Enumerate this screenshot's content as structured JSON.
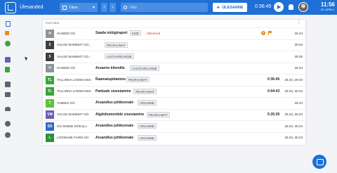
{
  "app": {
    "title": "Ülesanded"
  },
  "toolbar": {
    "date_value": "Täna",
    "prev_label": "‹",
    "next_label": "›",
    "search_placeholder": "Otsi",
    "new_button": "ÜLESANNE",
    "timer": "0:36:45"
  },
  "clock": {
    "time": "11:56",
    "date": "25. APRILL"
  },
  "sidebar": {
    "icons": [
      "tasks-icon",
      "flag-icon",
      "check-icon",
      "vm-icon",
      "document-icon",
      "calendar-icon",
      "briefcase-icon",
      "people-icon",
      "gear-icon",
      "help-icon"
    ]
  },
  "list": {
    "header": "Kuni täna",
    "rows": [
      {
        "tile": "H",
        "tile_color": "#8d939a",
        "client": "HUNDID OÜ",
        "task": "Saada müügiraport",
        "tags": [
          "KMD"
        ],
        "status": "Hilinenud",
        "time": "",
        "date": "25.04",
        "badge": "S",
        "flag": true
      },
      {
        "tile": "5",
        "tile_color": "#3e3e3e",
        "client": "VALGE MAMMUT OÜ…",
        "task": "",
        "tags": [
          "PEARAAMAT"
        ],
        "status": "",
        "time": "",
        "date": "30.04",
        "badge": "",
        "flag": false
      },
      {
        "tile": "5",
        "tile_color": "#3e3e3e",
        "client": "VALGE MAMMUT OÜ…",
        "task": "",
        "tags": [
          "AASTAARUANNE"
        ],
        "status": "",
        "time": "",
        "date": "28.06",
        "badge": "",
        "flag": false
      },
      {
        "tile": "H",
        "tile_color": "#8d939a",
        "client": "HUNDID OÜ",
        "task": "Aruanne kliendile",
        "tags": [
          "AASTAARUANNE"
        ],
        "status": "",
        "time": "",
        "date": "25.04",
        "badge": "",
        "flag": false
      },
      {
        "tile": "TL",
        "tile_color": "#3aa53a",
        "client": "TALLINNA LOOMAAED",
        "task": "Raamatupidamine",
        "tags": [
          "PEARAAMAT"
        ],
        "status": "",
        "time": "0:36:45",
        "date": "25.04, 29.04",
        "badge": "",
        "flag": false
      },
      {
        "tile": "TL",
        "tile_color": "#3aa53a",
        "client": "TALLINNA LOOMAAED",
        "task": "Pankade sisestamine",
        "tags": [
          "PEARAAMAT"
        ],
        "status": "",
        "time": "0:04:43",
        "date": "25.04, 30.04",
        "badge": "",
        "flag": false
      },
      {
        "tile": "T",
        "tile_color": "#5cc33a",
        "client": "TAMMAI OÜ",
        "task": "Aruandlus juhtkonnale",
        "tags": [
          "ARUANNE"
        ],
        "status": "",
        "time": "",
        "date": "25.04",
        "badge": "",
        "flag": false
      },
      {
        "tile": "VM",
        "tile_color": "#6a5fb4",
        "client": "VALGE MAMMUT OÜ",
        "task": "Algdokumentide sisestamine",
        "tags": [
          "PEARAAMAT"
        ],
        "status": "",
        "time": "5:26:26",
        "date": "25.04, 26.04",
        "badge": "",
        "flag": false
      },
      {
        "tile": "SD",
        "tile_color": "#2b6cc4",
        "client": "OÜ SININE DÖKULL",
        "task": "Aruandlus juhtkonnale",
        "tags": [
          "ARUANNE"
        ],
        "status": "",
        "time": "",
        "date": "25.04, 30.04",
        "badge": "",
        "flag": false
      },
      {
        "tile": "L",
        "tile_color": "#2f8f3a",
        "client": "LOOMADE FARM OÜ",
        "task": "Aruandlus juhtkonnale",
        "tags": [
          "ARUANNE"
        ],
        "status": "",
        "time": "",
        "date": "25.04, 30.04",
        "badge": "",
        "flag": false
      }
    ]
  },
  "colors": {
    "topbar": "#1e6fd6",
    "late_status": "#d93025",
    "priority": "#f08a1c"
  }
}
